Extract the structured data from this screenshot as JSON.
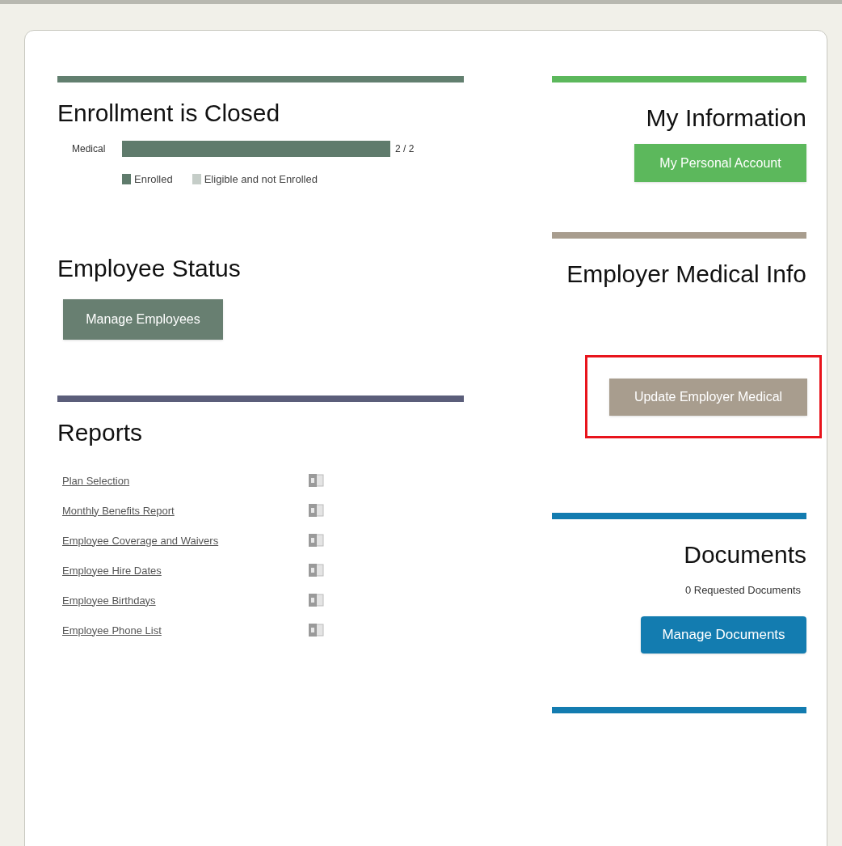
{
  "enrollment": {
    "title": "Enrollment is Closed",
    "bars": [
      {
        "label": "Medical",
        "level": 1.0,
        "reading": "2 / 2"
      }
    ],
    "legend": [
      {
        "label": "Enrolled",
        "color": "#5f7b6c"
      },
      {
        "label": "Eligible and not Enrolled",
        "color": "#c5cdc8"
      }
    ]
  },
  "employee_status": {
    "title": "Employee Status",
    "button": "Manage Employees"
  },
  "reports": {
    "title": "Reports",
    "items": [
      {
        "label": "Plan Selection"
      },
      {
        "label": "Monthly Benefits Report"
      },
      {
        "label": "Employee Coverage and Waivers"
      },
      {
        "label": "Employee Hire Dates"
      },
      {
        "label": "Employee Birthdays"
      },
      {
        "label": "Employee Phone List"
      }
    ]
  },
  "my_information": {
    "title": "My Information",
    "button": "My Personal Account"
  },
  "employer_medical": {
    "title": "Employer Medical Info",
    "button": "Update Employer Medical",
    "highlighted": true
  },
  "documents": {
    "title": "Documents",
    "count": "0 Requested Documents",
    "button": "Manage Documents"
  }
}
